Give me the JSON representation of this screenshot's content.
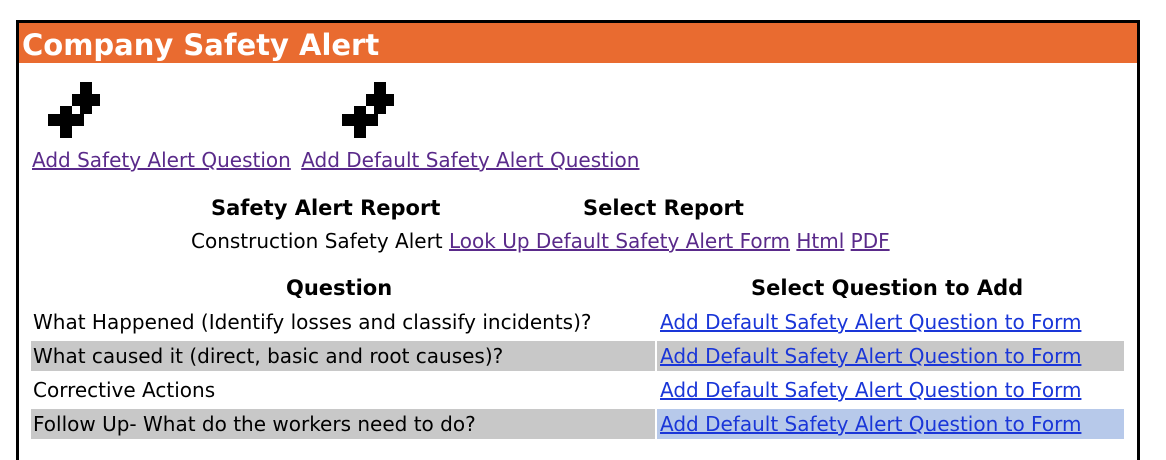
{
  "header": {
    "title": "Company Safety Alert"
  },
  "actions": {
    "add_question": "Add Safety Alert Question",
    "add_default_question": "Add Default Safety Alert Question",
    "icons": [
      "add-move-icon",
      "add-move-icon"
    ]
  },
  "report": {
    "col_report": "Safety Alert Report",
    "col_select": "Select Report",
    "name": "Construction Safety Alert",
    "lookup_link": "Look Up Default Safety Alert Form",
    "html_link": "Html",
    "pdf_link": "PDF"
  },
  "questions": {
    "col_question": "Question",
    "col_select": "Select Question to Add",
    "rows": [
      {
        "question": "What Happened (Identify losses and classify incidents)?",
        "action": "Add Default Safety Alert Question to Form"
      },
      {
        "question": "What caused it (direct, basic and root causes)?",
        "action": "Add Default Safety Alert Question to Form"
      },
      {
        "question": "Corrective Actions",
        "action": "Add Default Safety Alert Question to Form"
      },
      {
        "question": "Follow Up- What do the workers need to do?",
        "action": "Add Default Safety Alert Question to Form"
      }
    ]
  }
}
